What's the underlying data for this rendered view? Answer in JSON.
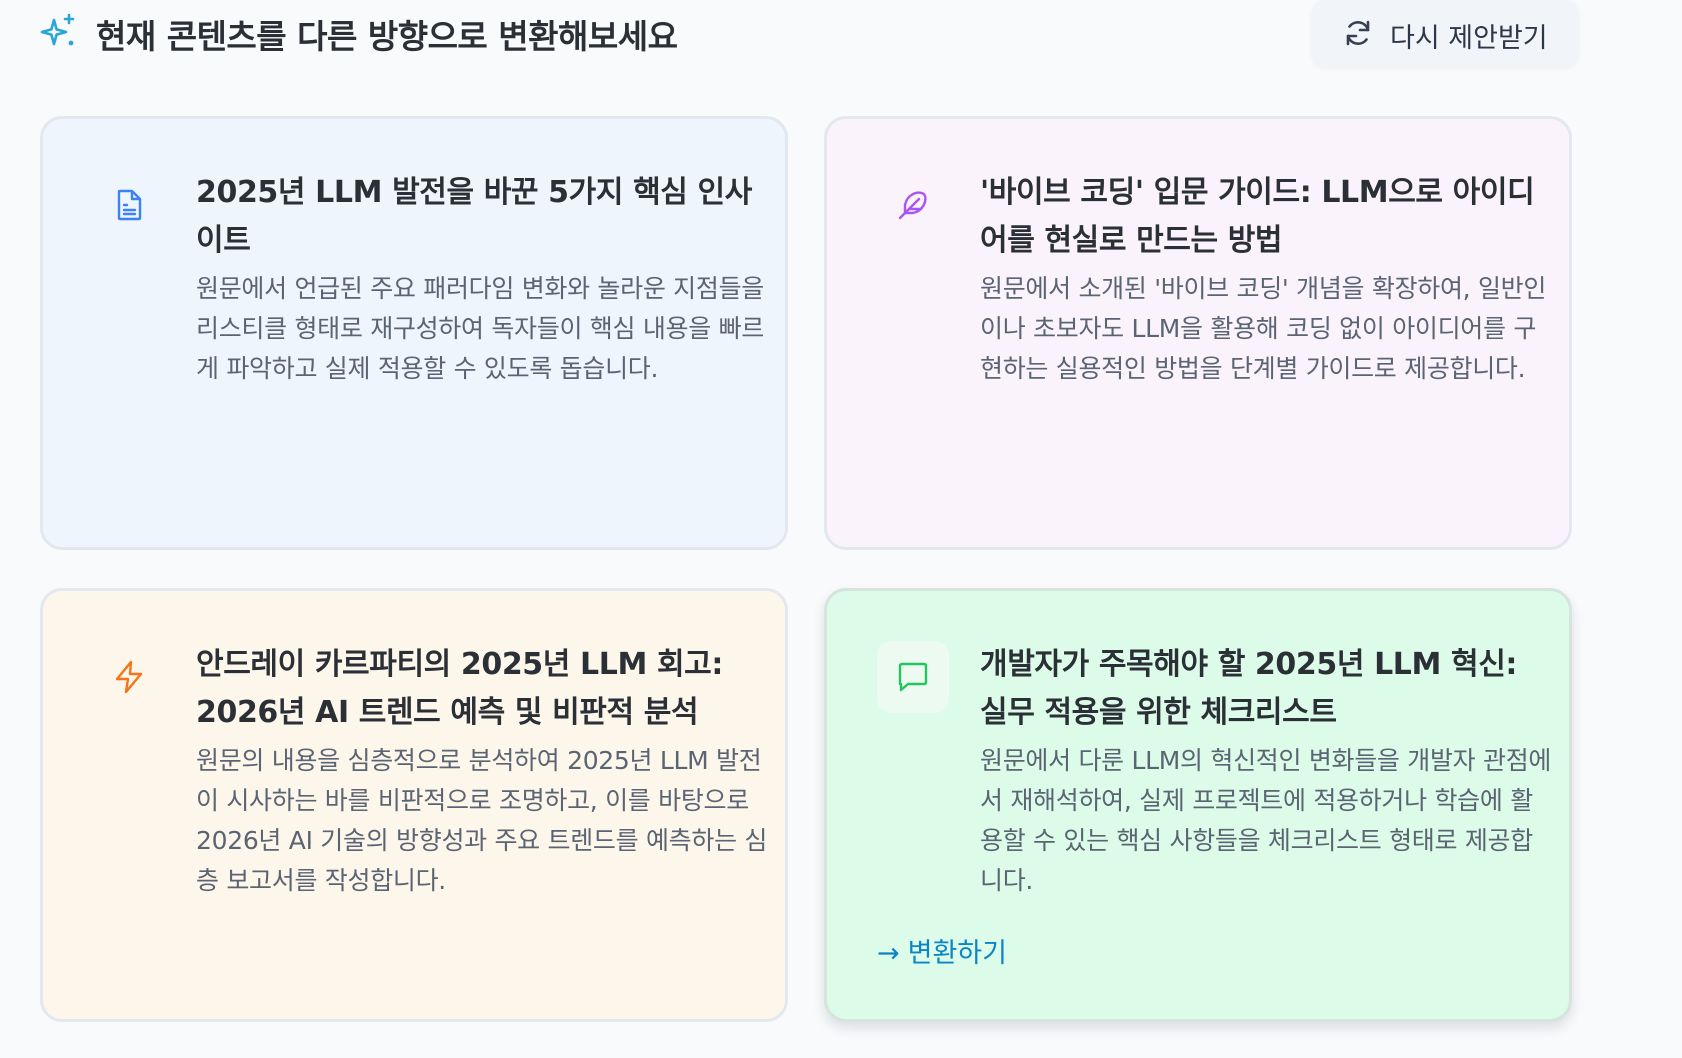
{
  "header": {
    "title": "현재 콘텐츠를 다른 방향으로 변환해보세요",
    "icon": "sparkles-icon",
    "refresh_label": "다시 제안받기",
    "refresh_icon": "refresh-icon"
  },
  "cards": [
    {
      "icon": "document-icon",
      "icon_color": "#3b82f6",
      "background": "#eff5fd",
      "title": "2025년 LLM 발전을 바꾼 5가지 핵심 인사이트",
      "description": "원문에서 언급된 주요 패러다임 변화와 놀라운 지점들을 리스티클 형태로 재구성하여 독자들이 핵심 내용을 빠르게 파악하고 실제 적용할 수 있도록 돕습니다."
    },
    {
      "icon": "feather-icon",
      "icon_color": "#a855f7",
      "background": "#faf3fc",
      "title": "'바이브 코딩' 입문 가이드: LLM으로 아이디어를 현실로 만드는 방법",
      "description": "원문에서 소개된 '바이브 코딩' 개념을 확장하여, 일반인이나 초보자도 LLM을 활용해 코딩 없이 아이디어를 구현하는 실용적인 방법을 단계별 가이드로 제공합니다."
    },
    {
      "icon": "lightning-icon",
      "icon_color": "#f97316",
      "background": "#fdf6eb",
      "title": "안드레이 카르파티의 2025년 LLM 회고: 2026년 AI 트렌드 예측 및 비판적 분석",
      "description": "원문의 내용을 심층적으로 분석하여 2025년 LLM 발전이 시사하는 바를 비판적으로 조명하고, 이를 바탕으로 2026년 AI 기술의 방향성과 주요 트렌드를 예측하는 심층 보고서를 작성합니다."
    },
    {
      "icon": "chat-bubble-icon",
      "icon_color": "#22c55e",
      "background": "#dcfce9",
      "title": "개발자가 주목해야 할 2025년 LLM 혁신: 실무 적용을 위한 체크리스트",
      "description": "원문에서 다룬 LLM의 혁신적인 변화들을 개발자 관점에서 재해석하여, 실제 프로젝트에 적용하거나 학습에 활용할 수 있는 핵심 사항들을 체크리스트 형태로 제공합니다.",
      "action_label": "변환하기",
      "action_arrow": "→",
      "action_color": "#0b85c7"
    }
  ]
}
